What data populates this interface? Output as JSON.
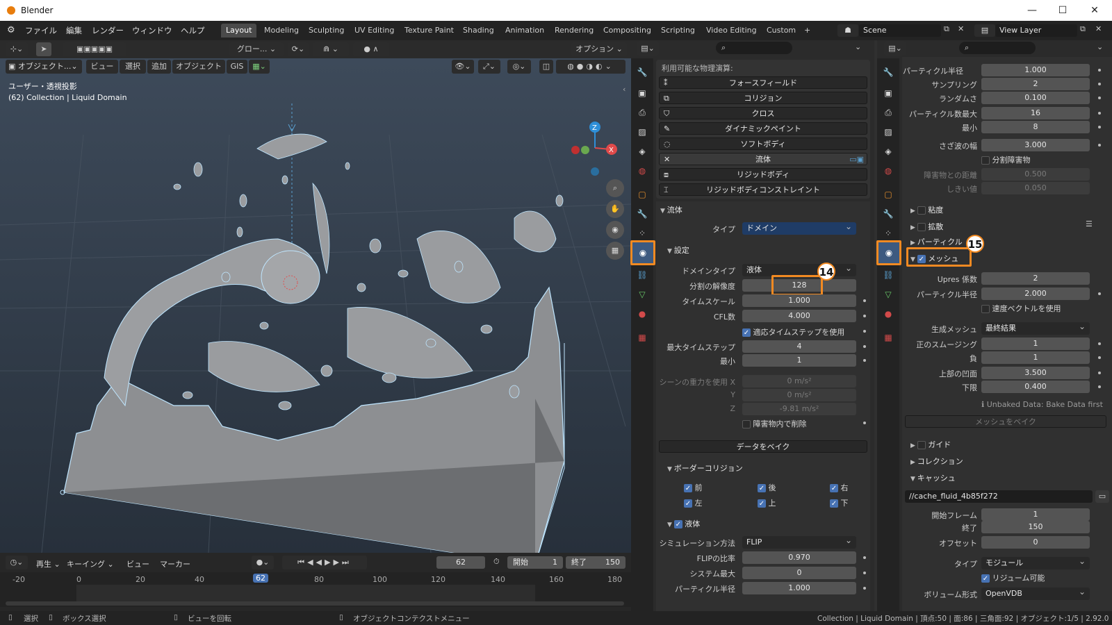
{
  "window": {
    "title": "Blender",
    "minimize": "—",
    "maximize": "☐",
    "close": "✕"
  },
  "menu": {
    "items": [
      "ファイル",
      "編集",
      "レンダー",
      "ウィンドウ",
      "ヘルプ"
    ]
  },
  "workspaces": [
    "Layout",
    "Modeling",
    "Sculpting",
    "UV Editing",
    "Texture Paint",
    "Shading",
    "Animation",
    "Rendering",
    "Compositing",
    "Scripting",
    "Video Editing",
    "Custom",
    "+"
  ],
  "scene": {
    "name": "Scene",
    "view_layer": "View Layer"
  },
  "viewport": {
    "header": {
      "transform": "グロー...",
      "options": "オプション",
      "mode": "オブジェクト...",
      "view": "ビュー",
      "select": "選択",
      "add": "追加",
      "object": "オブジェクト",
      "gis": "GIS"
    },
    "overlay_line1": "ユーザー・透視投影",
    "overlay_line2": "(62) Collection | Liquid Domain",
    "gizmo": {
      "z": "Z",
      "x": "X"
    }
  },
  "timeline": {
    "play": "再生",
    "keying": "キーイング",
    "view": "ビュー",
    "marker": "マーカー",
    "current": "62",
    "start_label": "開始",
    "start": "1",
    "end_label": "終了",
    "end": "150",
    "ticks": [
      "-20",
      "0",
      "20",
      "40",
      "62",
      "80",
      "100",
      "120",
      "140",
      "160",
      "180"
    ]
  },
  "statusbar": {
    "select": "選択",
    "box_select": "ボックス選択",
    "rotate_view": "ビューを回転",
    "context_menu": "オブジェクトコンテクストメニュー",
    "stats": "Collection | Liquid Domain | 頂点:50 | 面:86 | 三角面:92 | オブジェクト:1/5 | 2.92.0"
  },
  "physics_panel": {
    "available": "利用可能な物理演算:",
    "buttons": [
      "フォースフィールド",
      "コリジョン",
      "クロス",
      "ダイナミックペイント",
      "ソフトボディ",
      "流体",
      "リジッドボディ",
      "リジッドボディコンストレイント"
    ],
    "fluid_header": "流体",
    "type_label": "タイプ",
    "type_value": "ドメイン",
    "settings_header": "設定",
    "domain_type_label": "ドメインタイプ",
    "domain_type_value": "液体",
    "resolution_label": "分割の解像度",
    "resolution_value": "128",
    "timescale_label": "タイムスケール",
    "timescale_value": "1.000",
    "cfl_label": "CFL数",
    "cfl_value": "4.000",
    "adaptive_label": "適応タイムステップを使用",
    "max_ts_label": "最大タイムステップ",
    "max_ts_value": "4",
    "min_label": "最小",
    "min_value": "1",
    "gravity_x_label": "シーンの重力を使用 X",
    "gravity_x": "0 m/s²",
    "gravity_y_label": "Y",
    "gravity_y": "0 m/s²",
    "gravity_z_label": "Z",
    "gravity_z": "-9.81 m/s²",
    "delete_obstacle": "障害物内で削除",
    "bake_data": "データをベイク",
    "border_header": "ボーダーコリジョン",
    "border": [
      "前",
      "後",
      "右",
      "左",
      "上",
      "下"
    ],
    "liquid_header": "液体",
    "sim_method_label": "シミュレーション方法",
    "sim_method": "FLIP",
    "flip_ratio_label": "FLIPの比率",
    "flip_ratio": "0.970",
    "system_max_label": "システム最大",
    "system_max": "0",
    "particle_radius_label": "パーティクル半径",
    "particle_radius": "1.000"
  },
  "right_panel": {
    "particle_radius_label": "パーティクル半径",
    "particle_radius": "1.000",
    "sampling_label": "サンプリング",
    "sampling": "2",
    "randomness_label": "ランダムさ",
    "randomness": "0.100",
    "particle_max_label": "パーティクル数最大",
    "particle_max": "16",
    "min_label": "最小",
    "min": "8",
    "wave_label": "さざ波の幅",
    "wave": "3.000",
    "split_obstacle": "分割障害物",
    "obstacle_dist_label": "障害物との距離",
    "obstacle_dist": "0.500",
    "threshold_label": "しきい値",
    "threshold": "0.050",
    "viscosity": "粘度",
    "diffusion": "拡散",
    "particle": "パーティクル",
    "mesh": "メッシュ",
    "upres_label": "Upres 係数",
    "upres": "2",
    "mesh_radius_label": "パーティクル半径",
    "mesh_radius": "2.000",
    "use_velocity": "速度ベクトルを使用",
    "gen_mesh_label": "生成メッシュ",
    "gen_mesh": "最終結果",
    "smooth_pos_label": "正のスムージング",
    "smooth_pos": "1",
    "smooth_neg_label": "負",
    "smooth_neg": "1",
    "concave_upper_label": "上部の凹面",
    "concave_upper": "3.500",
    "concave_lower_label": "下限",
    "concave_lower": "0.400",
    "unbaked": "Unbaked Data: Bake Data first",
    "bake_mesh": "メッシュをベイク",
    "guide": "ガイド",
    "collection": "コレクション",
    "cache": "キャッシュ",
    "cache_path": "//cache_fluid_4b85f272",
    "start_frame_label": "開始フレーム",
    "start_frame": "1",
    "end_label": "終了",
    "end": "150",
    "offset_label": "オフセット",
    "offset": "0",
    "type_label": "タイプ",
    "type": "モジュール",
    "resumable": "リジューム可能",
    "volume_format_label": "ボリューム形式",
    "volume_format": "OpenVDB"
  },
  "annotations": {
    "b14": "14",
    "b15": "15"
  },
  "colors": {
    "accent": "#f28a22",
    "blue": "#4772b3",
    "viewport_top": "#3d4a5a",
    "viewport_bottom": "#2a3340"
  }
}
